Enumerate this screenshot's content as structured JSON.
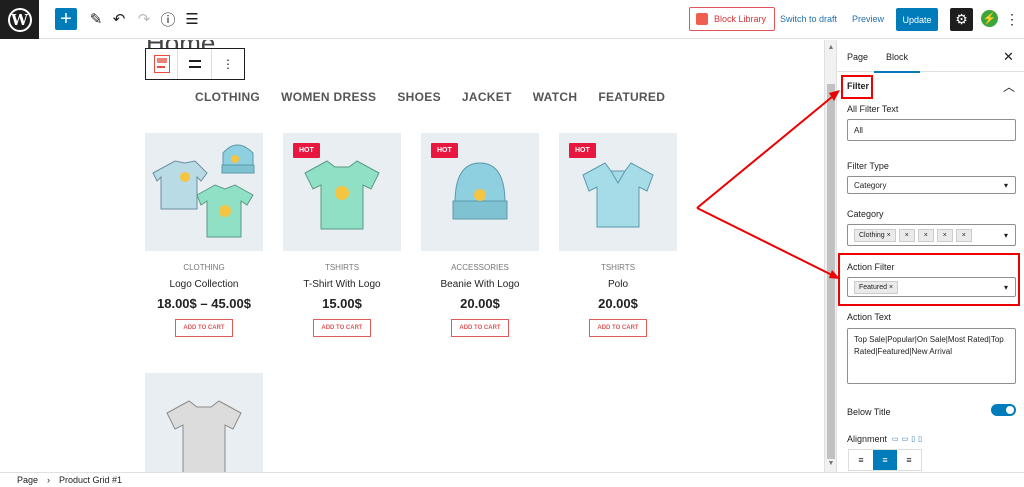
{
  "toolbar": {
    "add_icon": "plus-icon",
    "block_library_label": "Block Library",
    "switch_to_draft_label": "Switch to draft",
    "preview_label": "Preview",
    "update_label": "Update"
  },
  "canvas": {
    "page_heading": "Home",
    "filters": [
      "CLOTHING",
      "WOMEN DRESS",
      "SHOES",
      "JACKET",
      "WATCH",
      "FEATURED"
    ],
    "hot_badge": "HOT",
    "add_to_cart_label": "ADD TO CART",
    "products": [
      {
        "category": "CLOTHING",
        "name": "Logo Collection",
        "price": "18.00$ – 45.00$",
        "hot": false
      },
      {
        "category": "TSHIRTS",
        "name": "T-Shirt With Logo",
        "price": "15.00$",
        "hot": true
      },
      {
        "category": "ACCESSORIES",
        "name": "Beanie With Logo",
        "price": "20.00$",
        "hot": true
      },
      {
        "category": "TSHIRTS",
        "name": "Polo",
        "price": "20.00$",
        "hot": true
      }
    ]
  },
  "sidebar": {
    "tabs": [
      "Page",
      "Block"
    ],
    "active_tab": "Block",
    "section_title": "Filter",
    "all_filter_text_label": "All Filter Text",
    "all_filter_text_value": "All",
    "filter_type_label": "Filter Type",
    "filter_type_value": "Category",
    "category_label": "Category",
    "category_tag": "Clothing",
    "action_filter_label": "Action Filter",
    "action_filter_tag": "Featured",
    "action_text_label": "Action Text",
    "action_text_value": "Top Sale|Popular|On Sale|Most Rated|Top Rated|Featured|New Arrival",
    "below_title_label": "Below Title",
    "alignment_label": "Alignment"
  },
  "footer": {
    "crumb_root": "Page",
    "crumb_current": "Product Grid #1"
  },
  "colors": {
    "accent": "#007cba",
    "hot": "#e8173f",
    "annotation": "#e00000"
  }
}
